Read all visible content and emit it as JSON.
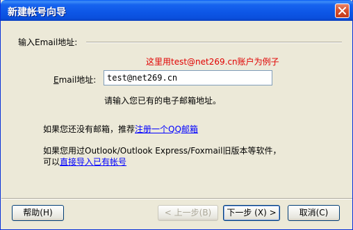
{
  "window": {
    "title": "新建帐号向导"
  },
  "group": {
    "label": "输入Email地址:"
  },
  "hint": "这里用test@net269.cn账户为例子",
  "email": {
    "label_prefix": "E",
    "label_rest": "mail地址:",
    "value": "test@net269.cn",
    "note": "请输入您已有的电子邮箱地址。"
  },
  "register": {
    "text": "如果您还没有邮箱，推荐",
    "link": "注册一个QQ邮箱"
  },
  "import": {
    "line1": "如果您用过Outlook/Outlook Express/Foxmail旧版本等软件，",
    "line2_prefix": "可以",
    "link": "直接导入已有帐号"
  },
  "buttons": {
    "help": "帮助(H)",
    "prev": "< 上一步(B)",
    "next": "下一步 (X) >",
    "cancel": "取消(C)"
  },
  "colors": {
    "titlebar": "#0a4fdc",
    "hint": "#e00000",
    "link": "#0000ff"
  }
}
